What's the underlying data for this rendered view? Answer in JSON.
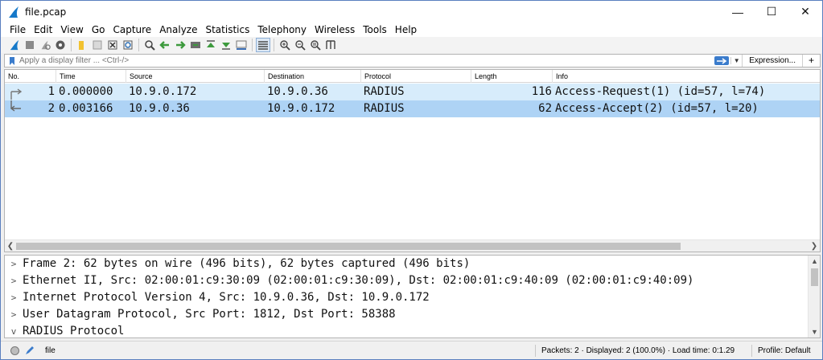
{
  "window": {
    "title": "file.pcap"
  },
  "menu": [
    "File",
    "Edit",
    "View",
    "Go",
    "Capture",
    "Analyze",
    "Statistics",
    "Telephony",
    "Wireless",
    "Tools",
    "Help"
  ],
  "filter": {
    "placeholder": "Apply a display filter ... <Ctrl-/>",
    "expression_label": "Expression...",
    "plus_label": "+"
  },
  "packet_list": {
    "columns": [
      "No.",
      "Time",
      "Source",
      "Destination",
      "Protocol",
      "Length",
      "Info"
    ],
    "rows": [
      {
        "no": "1",
        "time": "0.000000",
        "source": "10.9.0.172",
        "destination": "10.9.0.36",
        "protocol": "RADIUS",
        "length": "116",
        "info": "Access-Request(1) (id=57, l=74)"
      },
      {
        "no": "2",
        "time": "0.003166",
        "source": "10.9.0.36",
        "destination": "10.9.0.172",
        "protocol": "RADIUS",
        "length": "62",
        "info": "Access-Accept(2) (id=57, l=20)"
      }
    ]
  },
  "details": [
    {
      "chevron": ">",
      "text": "Frame 2: 62 bytes on wire (496 bits), 62 bytes captured (496 bits)"
    },
    {
      "chevron": ">",
      "text": "Ethernet II, Src: 02:00:01:c9:30:09 (02:00:01:c9:30:09), Dst: 02:00:01:c9:40:09 (02:00:01:c9:40:09)"
    },
    {
      "chevron": ">",
      "text": "Internet Protocol Version 4, Src: 10.9.0.36, Dst: 10.9.0.172"
    },
    {
      "chevron": ">",
      "text": "User Datagram Protocol, Src Port: 1812, Dst Port: 58388"
    },
    {
      "chevron": "v",
      "text": "RADIUS Protocol"
    }
  ],
  "status": {
    "file": "file",
    "packets": "Packets: 2 · Displayed: 2 (100.0%) · Load time: 0:1.29",
    "profile": "Profile: Default"
  },
  "colors": {
    "row_selected": "#aed3f5",
    "row_normal": "#d7ecfb",
    "accent": "#3b7ccc"
  }
}
